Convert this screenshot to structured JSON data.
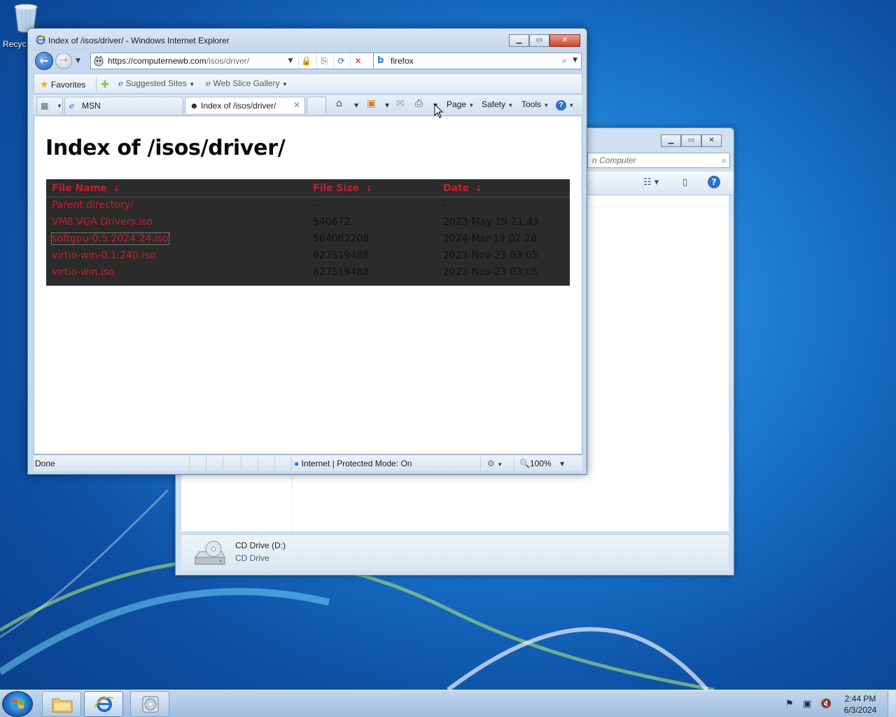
{
  "desktop": {
    "recycle_bin_label": "Recyc"
  },
  "explorer": {
    "search_placeholder": "n Computer",
    "device_name": "CD Drive (D:)",
    "device_type": "CD Drive"
  },
  "ie": {
    "title": "Index of /isos/driver/ - Windows Internet Explorer",
    "address": {
      "host": "https://computernewb.com",
      "path": "/isos/driver/"
    },
    "search_query": "firefox",
    "favorites_bar": {
      "favorites_label": "Favorites",
      "suggested_sites_label": "Suggested Sites",
      "web_slice_label": "Web Slice Gallery"
    },
    "tabs": [
      {
        "label": "MSN"
      },
      {
        "label": "Index of /isos/driver/"
      }
    ],
    "command_bar": {
      "page_label": "Page",
      "safety_label": "Safety",
      "tools_label": "Tools"
    },
    "status_bar": {
      "status_text": "Done",
      "zone_text": "Internet | Protected Mode: On",
      "zoom_text": "100%"
    }
  },
  "page": {
    "heading": "Index of /isos/driver/",
    "columns": {
      "name": "File Name",
      "name_sort": "↓",
      "size": "File Size",
      "size_sort": "↓",
      "date": "Date",
      "date_sort": "↓"
    },
    "rows": [
      {
        "name": "Parent directory/",
        "size": "-",
        "date": "-"
      },
      {
        "name": "VM8 VGA Drivers.iso",
        "size": "540672",
        "date": "2023-May-19 21:43"
      },
      {
        "name": "softgpu-0.5.2024.24.iso",
        "size": "564062208",
        "date": "2024-Mar-19 02:28"
      },
      {
        "name": "virtio-win-0.1.240.iso",
        "size": "627519488",
        "date": "2023-Nov-23 03:05"
      },
      {
        "name": "virtio-win.iso",
        "size": "627519488",
        "date": "2023-Nov-23 03:05"
      }
    ]
  },
  "taskbar": {
    "clock_time": "2:44 PM",
    "clock_date": "6/3/2024"
  },
  "colors": {
    "link_red": "#c21f2c",
    "listing_bg": "#2b2b2b",
    "desktop_blue": "#1a78cf"
  }
}
